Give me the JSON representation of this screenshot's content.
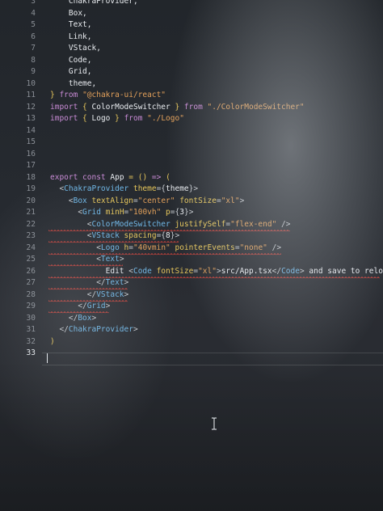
{
  "editor": {
    "lines": [
      {
        "no": "3",
        "tokens": [
          {
            "t": "    ChakraProvider,",
            "c": "ident"
          }
        ]
      },
      {
        "no": "4",
        "tokens": [
          {
            "t": "    Box,",
            "c": "ident"
          }
        ]
      },
      {
        "no": "5",
        "tokens": [
          {
            "t": "    Text,",
            "c": "ident"
          }
        ]
      },
      {
        "no": "6",
        "tokens": [
          {
            "t": "    Link,",
            "c": "ident"
          }
        ]
      },
      {
        "no": "7",
        "tokens": [
          {
            "t": "    VStack,",
            "c": "ident"
          }
        ]
      },
      {
        "no": "8",
        "tokens": [
          {
            "t": "    Code,",
            "c": "ident"
          }
        ]
      },
      {
        "no": "9",
        "tokens": [
          {
            "t": "    Grid,",
            "c": "ident"
          }
        ]
      },
      {
        "no": "10",
        "tokens": [
          {
            "t": "    theme,",
            "c": "ident"
          }
        ]
      },
      {
        "no": "11",
        "tokens": [
          {
            "t": "} ",
            "c": "brace"
          },
          {
            "t": "from ",
            "c": "kw"
          },
          {
            "t": "\"@chakra-ui/react\"",
            "c": "str"
          }
        ]
      },
      {
        "no": "12",
        "tokens": [
          {
            "t": "import ",
            "c": "kw"
          },
          {
            "t": "{ ",
            "c": "brace"
          },
          {
            "t": "ColorModeSwitcher ",
            "c": "ident"
          },
          {
            "t": "} ",
            "c": "brace"
          },
          {
            "t": "from ",
            "c": "kw"
          },
          {
            "t": "\"./ColorModeSwitcher\"",
            "c": "str"
          }
        ]
      },
      {
        "no": "13",
        "tokens": [
          {
            "t": "import ",
            "c": "kw"
          },
          {
            "t": "{ ",
            "c": "brace"
          },
          {
            "t": "Logo ",
            "c": "ident"
          },
          {
            "t": "} ",
            "c": "brace"
          },
          {
            "t": "from ",
            "c": "kw"
          },
          {
            "t": "\"./Logo\"",
            "c": "str"
          }
        ]
      },
      {
        "no": "14",
        "tokens": []
      },
      {
        "no": "15",
        "tokens": []
      },
      {
        "no": "16",
        "tokens": []
      },
      {
        "no": "17",
        "tokens": []
      },
      {
        "no": "18",
        "tokens": [
          {
            "t": "export ",
            "c": "kw"
          },
          {
            "t": "const ",
            "c": "kw"
          },
          {
            "t": "App ",
            "c": "ident"
          },
          {
            "t": "= ",
            "c": "op"
          },
          {
            "t": "() ",
            "c": "brace"
          },
          {
            "t": "=> ",
            "c": "kw"
          },
          {
            "t": "(",
            "c": "brace"
          }
        ]
      },
      {
        "no": "19",
        "tokens": [
          {
            "t": "  <",
            "c": "punc"
          },
          {
            "t": "ChakraProvider ",
            "c": "tag"
          },
          {
            "t": "theme",
            "c": "attr"
          },
          {
            "t": "={",
            "c": "punc"
          },
          {
            "t": "theme",
            "c": "ident"
          },
          {
            "t": "}>",
            "c": "punc"
          }
        ]
      },
      {
        "no": "20",
        "tokens": [
          {
            "t": "    <",
            "c": "punc"
          },
          {
            "t": "Box ",
            "c": "tag"
          },
          {
            "t": "textAlign",
            "c": "attr"
          },
          {
            "t": "=",
            "c": "punc"
          },
          {
            "t": "\"center\" ",
            "c": "str"
          },
          {
            "t": "fontSize",
            "c": "attr"
          },
          {
            "t": "=",
            "c": "punc"
          },
          {
            "t": "\"xl\"",
            "c": "str"
          },
          {
            "t": ">",
            "c": "punc"
          }
        ]
      },
      {
        "no": "21",
        "tokens": [
          {
            "t": "      <",
            "c": "punc"
          },
          {
            "t": "Grid ",
            "c": "tag"
          },
          {
            "t": "minH",
            "c": "attr"
          },
          {
            "t": "=",
            "c": "punc"
          },
          {
            "t": "\"100vh\" ",
            "c": "str"
          },
          {
            "t": "p",
            "c": "attr"
          },
          {
            "t": "={",
            "c": "punc"
          },
          {
            "t": "3",
            "c": "ident"
          },
          {
            "t": "}>",
            "c": "punc"
          }
        ]
      },
      {
        "no": "22",
        "tokens": [
          {
            "t": "        <",
            "c": "punc"
          },
          {
            "t": "ColorModeSwitcher ",
            "c": "tag"
          },
          {
            "t": "justifySelf",
            "c": "attr"
          },
          {
            "t": "=",
            "c": "punc"
          },
          {
            "t": "\"flex-end\" ",
            "c": "str"
          },
          {
            "t": "/>",
            "c": "punc"
          }
        ]
      },
      {
        "no": "23",
        "tokens": [
          {
            "t": "        <",
            "c": "punc"
          },
          {
            "t": "VStack ",
            "c": "tag"
          },
          {
            "t": "spacing",
            "c": "attr"
          },
          {
            "t": "={",
            "c": "punc"
          },
          {
            "t": "8",
            "c": "ident"
          },
          {
            "t": "}>",
            "c": "punc"
          }
        ]
      },
      {
        "no": "24",
        "tokens": [
          {
            "t": "          <",
            "c": "punc"
          },
          {
            "t": "Logo ",
            "c": "tag"
          },
          {
            "t": "h",
            "c": "attr"
          },
          {
            "t": "=",
            "c": "punc"
          },
          {
            "t": "\"40vmin\" ",
            "c": "str"
          },
          {
            "t": "pointerEvents",
            "c": "attr"
          },
          {
            "t": "=",
            "c": "punc"
          },
          {
            "t": "\"none\" ",
            "c": "str"
          },
          {
            "t": "/>",
            "c": "punc"
          }
        ]
      },
      {
        "no": "25",
        "tokens": [
          {
            "t": "          <",
            "c": "punc"
          },
          {
            "t": "Text",
            "c": "tag"
          },
          {
            "t": ">",
            "c": "punc"
          }
        ]
      },
      {
        "no": "26",
        "tokens": [
          {
            "t": "            Edit ",
            "c": "txt"
          },
          {
            "t": "<",
            "c": "punc"
          },
          {
            "t": "Code ",
            "c": "tag"
          },
          {
            "t": "fontSize",
            "c": "attr"
          },
          {
            "t": "=",
            "c": "punc"
          },
          {
            "t": "\"xl\"",
            "c": "str"
          },
          {
            "t": ">",
            "c": "punc"
          },
          {
            "t": "src/App.tsx",
            "c": "txt"
          },
          {
            "t": "</",
            "c": "punc"
          },
          {
            "t": "Code",
            "c": "tag"
          },
          {
            "t": "> ",
            "c": "punc"
          },
          {
            "t": "and save to reload.",
            "c": "txt"
          }
        ]
      },
      {
        "no": "27",
        "tokens": [
          {
            "t": "          </",
            "c": "punc"
          },
          {
            "t": "Text",
            "c": "tag"
          },
          {
            "t": ">",
            "c": "punc"
          }
        ]
      },
      {
        "no": "28",
        "tokens": [
          {
            "t": "        </",
            "c": "punc"
          },
          {
            "t": "VStack",
            "c": "tag"
          },
          {
            "t": ">",
            "c": "punc"
          }
        ]
      },
      {
        "no": "29",
        "tokens": [
          {
            "t": "      </",
            "c": "punc"
          },
          {
            "t": "Grid",
            "c": "tag"
          },
          {
            "t": ">",
            "c": "punc"
          }
        ]
      },
      {
        "no": "30",
        "tokens": [
          {
            "t": "    </",
            "c": "punc"
          },
          {
            "t": "Box",
            "c": "tag"
          },
          {
            "t": ">",
            "c": "punc"
          }
        ]
      },
      {
        "no": "31",
        "tokens": [
          {
            "t": "  </",
            "c": "punc"
          },
          {
            "t": "ChakraProvider",
            "c": "tag"
          },
          {
            "t": ">",
            "c": "punc"
          }
        ]
      },
      {
        "no": "32",
        "tokens": [
          {
            "t": ")",
            "c": "brace"
          }
        ]
      },
      {
        "no": "33",
        "tokens": []
      }
    ],
    "active_line": "33",
    "colors": {
      "background": "#24272c",
      "keyword": "#c98bd6",
      "string": "#e2a05a",
      "tag": "#6fb8e8",
      "attribute": "#e6c65b",
      "error_squiggle": "#e2453c",
      "line_number": "#8a8f96"
    },
    "error_lines": [
      "22",
      "23",
      "24",
      "25",
      "26",
      "27",
      "28",
      "29"
    ],
    "mouse_cursor_icon": "i-beam-cursor-icon"
  }
}
